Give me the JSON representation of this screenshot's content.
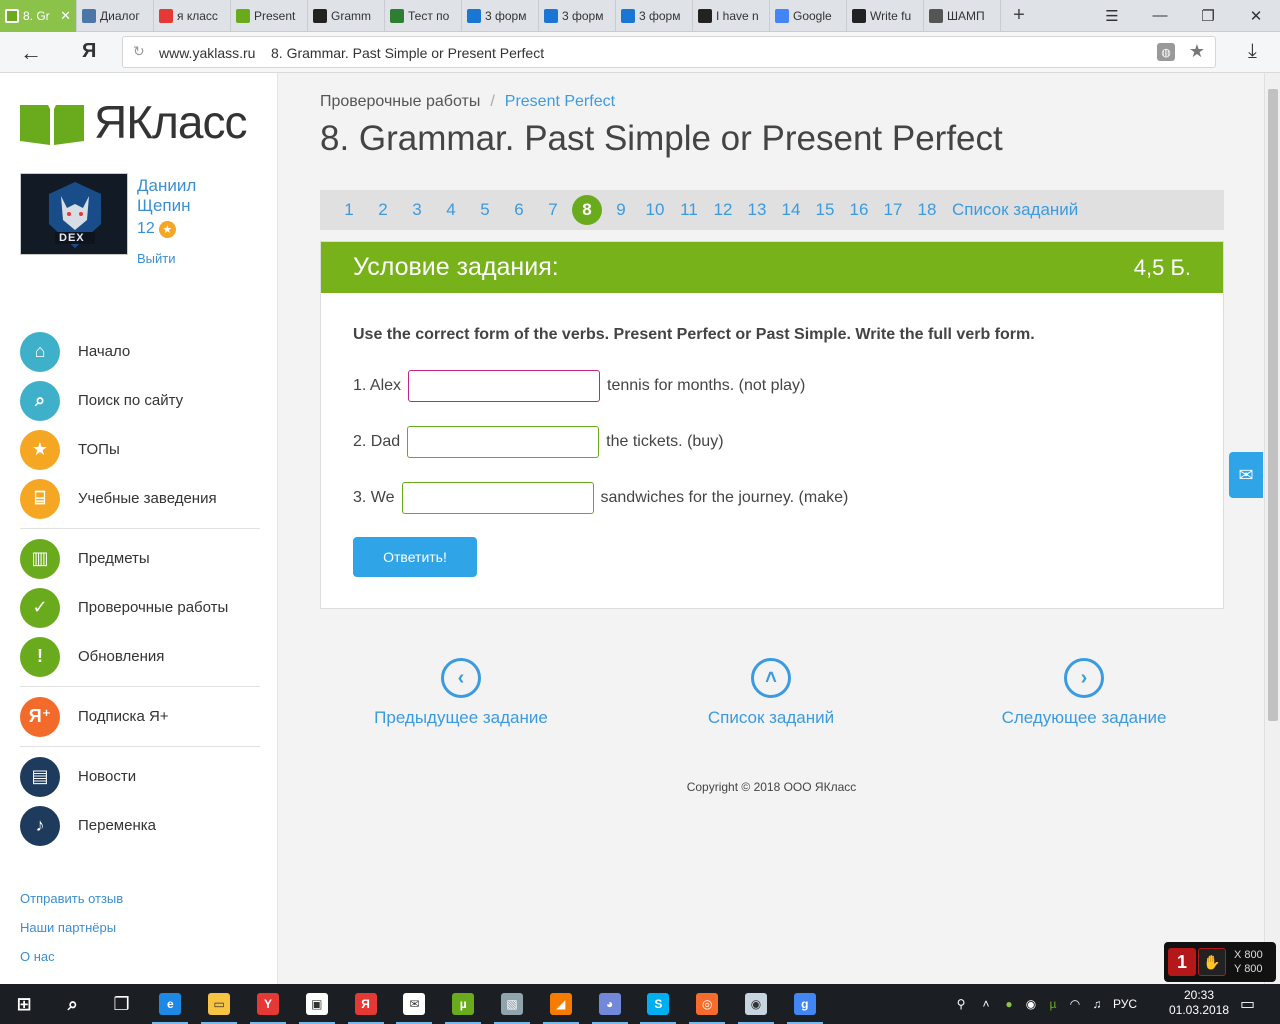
{
  "browser": {
    "tabs": [
      {
        "title": "8. Gr",
        "icon": "yaklass-book-icon",
        "color": "#6aab1e",
        "active": true
      },
      {
        "title": "Диалог",
        "icon": "chat-bubble-icon",
        "color": "#4a76a8"
      },
      {
        "title": "я класс",
        "icon": "yandex-icon",
        "color": "#e53935"
      },
      {
        "title": "Present",
        "icon": "yaklass-book-icon",
        "color": "#6aab1e"
      },
      {
        "title": "Gramm",
        "icon": "znanija-icon",
        "color": "#222"
      },
      {
        "title": "Тест по",
        "icon": "checkmark-icon",
        "color": "#2e7d32"
      },
      {
        "title": "3 форм",
        "icon": "e-icon",
        "color": "#1976d2"
      },
      {
        "title": "3 форм",
        "icon": "e-icon",
        "color": "#1976d2"
      },
      {
        "title": "3 форм",
        "icon": "e-icon",
        "color": "#1976d2"
      },
      {
        "title": "I have n",
        "icon": "znanija-icon",
        "color": "#222"
      },
      {
        "title": "Google",
        "icon": "google-translate-icon",
        "color": "#4285f4"
      },
      {
        "title": "Write fu",
        "icon": "znanija-icon",
        "color": "#222"
      },
      {
        "title": "ШАМП",
        "icon": "tower-icon",
        "color": "#555"
      }
    ],
    "new_tab": "+",
    "address": {
      "domain": "www.yaklass.ru",
      "page_title": "8. Grammar. Past Simple or Present Perfect"
    },
    "yandex_glyph": "Я"
  },
  "sidebar": {
    "brand": "ЯКласс",
    "user_name_line1": "Даниил",
    "user_name_line2": "Щепин",
    "points": "12",
    "avatar_text": "DEX",
    "logout": "Выйти",
    "menu": [
      {
        "label": "Начало",
        "icon": "home-icon",
        "glyph": "⌂",
        "color": "#3fb0c9"
      },
      {
        "label": "Поиск по сайту",
        "icon": "search-icon",
        "glyph": "⌕",
        "color": "#3fb0c9"
      },
      {
        "label": "ТОПы",
        "icon": "star-icon",
        "glyph": "★",
        "color": "#f5a623"
      },
      {
        "label": "Учебные заведения",
        "icon": "institution-icon",
        "glyph": "⌸",
        "color": "#f5a623"
      },
      {
        "label": "Предметы",
        "icon": "book-icon",
        "glyph": "▥",
        "color": "#6aab1e"
      },
      {
        "label": "Проверочные работы",
        "icon": "check-icon",
        "glyph": "✓",
        "color": "#6aab1e"
      },
      {
        "label": "Обновления",
        "icon": "exclamation-icon",
        "glyph": "!",
        "color": "#6aab1e"
      },
      {
        "label": "Подписка Я+",
        "icon": "ya-plus-icon",
        "glyph": "Я⁺",
        "color": "#f26b2a"
      },
      {
        "label": "Новости",
        "icon": "news-chat-icon",
        "glyph": "▤",
        "color": "#1e3a5c"
      },
      {
        "label": "Переменка",
        "icon": "bell-icon",
        "glyph": "♪",
        "color": "#1e3a5c"
      }
    ],
    "footer_links": [
      "Отправить отзыв",
      "Наши партнёры",
      "О нас"
    ]
  },
  "main": {
    "breadcrumb_parent": "Проверочные работы",
    "breadcrumb_sep": "/",
    "breadcrumb_current": "Present Perfect",
    "title": "8. Grammar. Past Simple or Present Perfect",
    "pages": [
      "1",
      "2",
      "3",
      "4",
      "5",
      "6",
      "7",
      "8",
      "9",
      "10",
      "11",
      "12",
      "13",
      "14",
      "15",
      "16",
      "17",
      "18"
    ],
    "active_page": "8",
    "task_list_link": "Список заданий",
    "task": {
      "header": "Условие задания:",
      "score": "4,5 Б.",
      "instruction": "Use the correct form of the verbs. Present Perfect or Past Simple. Write the full verb form.",
      "questions": [
        {
          "prefix": "1. Alex",
          "value": "",
          "suffix": "tennis for months. (not play)"
        },
        {
          "prefix": "2. Dad",
          "value": "",
          "suffix": "the tickets. (buy)"
        },
        {
          "prefix": "3. We",
          "value": "",
          "suffix": "sandwiches for the journey. (make)"
        }
      ],
      "submit": "Ответить!"
    },
    "nav": {
      "prev": "Предыдущее задание",
      "list": "Список заданий",
      "next": "Следующее задание"
    },
    "copyright": "Copyright © 2018 ООО ЯКласс"
  },
  "overlay": {
    "x": "X 800",
    "y": "Y 800",
    "badge": "1"
  },
  "taskbar": {
    "apps": [
      {
        "icon": "windows-start-icon",
        "color": "#ffffff"
      },
      {
        "icon": "search-icon",
        "color": "#ffffff"
      },
      {
        "icon": "task-view-icon",
        "color": "#ffffff"
      },
      {
        "icon": "edge-icon",
        "color": "#1e88e5"
      },
      {
        "icon": "file-explorer-icon",
        "color": "#f6c343"
      },
      {
        "icon": "yandex-browser-icon",
        "color": "#e53935"
      },
      {
        "icon": "store-icon",
        "color": "#ffffff"
      },
      {
        "icon": "yandex-icon",
        "color": "#e53935"
      },
      {
        "icon": "mail-icon",
        "color": "#ffffff"
      },
      {
        "icon": "utorrent-icon",
        "color": "#6aab1e"
      },
      {
        "icon": "photos-icon",
        "color": "#90a4ae"
      },
      {
        "icon": "winamp-icon",
        "color": "#f57c00"
      },
      {
        "icon": "discord-icon",
        "color": "#7289da"
      },
      {
        "icon": "skype-icon",
        "color": "#00aff0"
      },
      {
        "icon": "origin-icon",
        "color": "#f56c2d"
      },
      {
        "icon": "steam-icon",
        "color": "#c7d5e0"
      },
      {
        "icon": "gmail-icon",
        "color": "#4285f4"
      }
    ],
    "lang": "РУС",
    "time": "20:33",
    "date": "01.03.2018"
  }
}
